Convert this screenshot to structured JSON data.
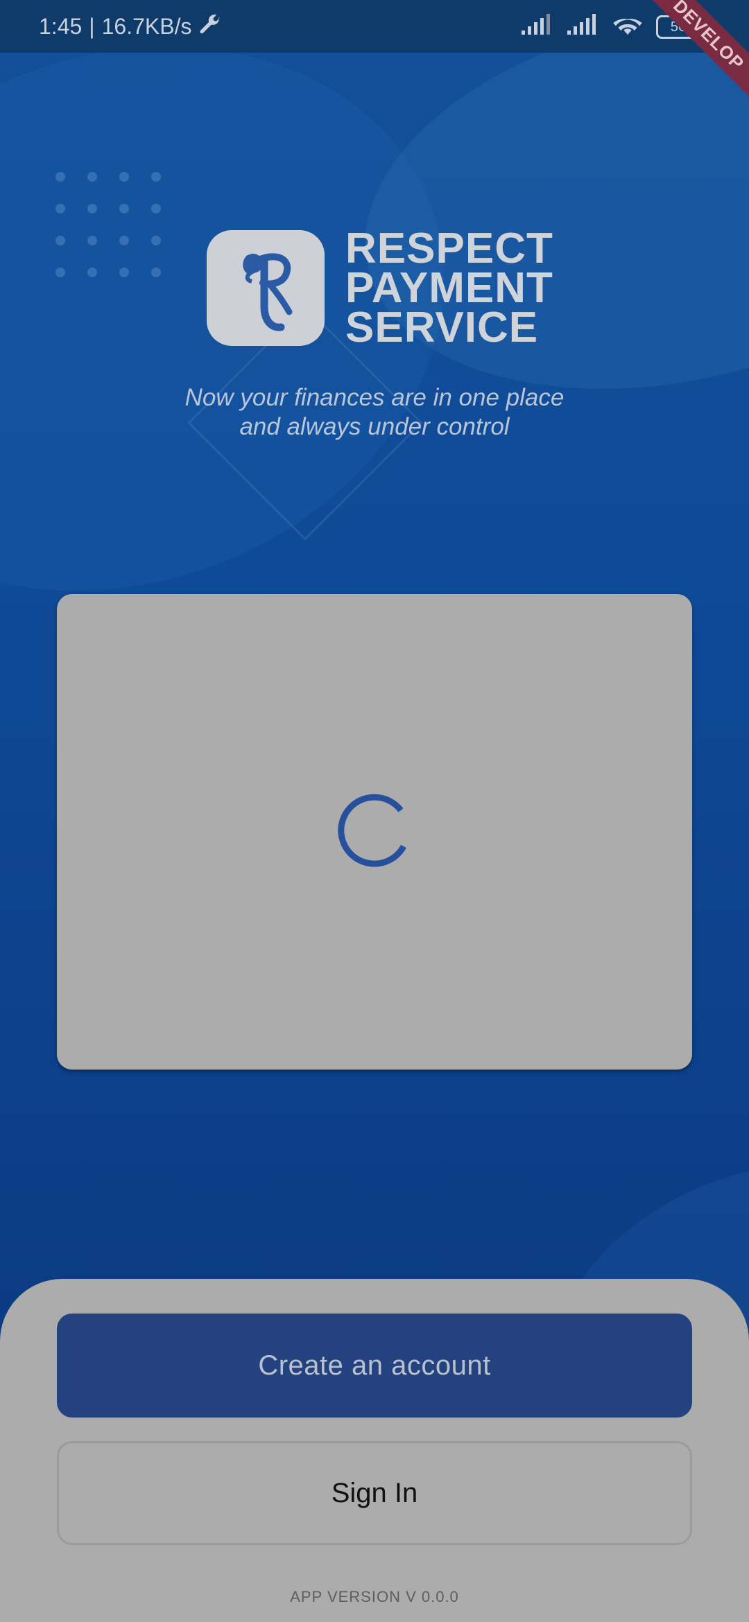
{
  "status_bar": {
    "time": "1:45",
    "speed": "16.7KB/s",
    "battery": "56",
    "icons": [
      "wrench-icon",
      "signal-icon",
      "signal-icon",
      "wifi-icon",
      "battery-icon"
    ]
  },
  "debug_banner": {
    "label": "DEVELOP"
  },
  "logo": {
    "line1": "RESPECT",
    "line2": "PAYMENT",
    "line3": "SERVICE"
  },
  "tagline": {
    "line1": "Now your finances are in one place",
    "line2": "and always under control"
  },
  "card": {
    "state": "loading",
    "spinner_icon": "loading-spinner-icon"
  },
  "actions": {
    "create_account": "Create an account",
    "sign_in": "Sign In"
  },
  "footer": {
    "version": "APP VERSION V 0.0.0"
  },
  "colors": {
    "background": "#0f4a97",
    "primary_button": "#23427f",
    "overlay_gray": "#acacac",
    "debug_ribbon": "#7b2a44"
  }
}
